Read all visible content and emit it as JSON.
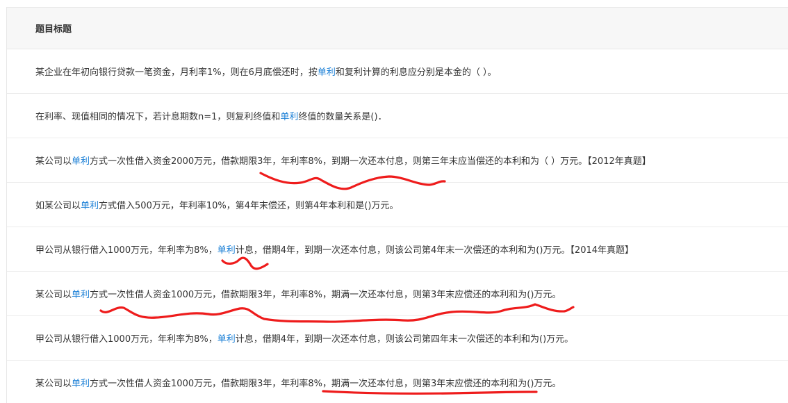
{
  "header": {
    "title": "题目标题"
  },
  "rows": [
    {
      "pre": "某企业在年初向银行贷款一笔资金，月利率1%，则在6月底偿还时，按",
      "link": "单利",
      "post": "和复利计算的利息应分别是本金的（ ）。"
    },
    {
      "pre": "在利率、现值相同的情况下，若计息期数n=1，则复利终值和",
      "link": "单利",
      "post": "终值的数量关系是()．"
    },
    {
      "pre": "某公司以",
      "link": "单利",
      "post": "方式一次性借入资金2000万元，借款期限3年，年利率8%，到期一次还本付息，则第三年末应当偿还的本利和为（ ）万元。【2012年真题】"
    },
    {
      "pre": "如某公司以",
      "link": "单利",
      "post": "方式借入500万元，年利率10%，第4年末偿还，则第4年本利和是()万元。"
    },
    {
      "pre": "甲公司从银行借入1000万元，年利率为8%，",
      "link": "单利",
      "post": "计息，借期4年，到期一次还本付息，则该公司第4年末一次偿还的本利和为()万元。【2014年真题】"
    },
    {
      "pre": "某公司以",
      "link": "单利",
      "post": "方式一次性借人资金1000万元，借款期限3年，年利率8%，期满一次还本付息，则第3年末应偿还的本利和为()万元。"
    },
    {
      "pre": "甲公司从银行借入1000万元，年利率为8%，",
      "link": "单利",
      "post": "计息，借期4年，到期一次还本付息，则该公司第四年末一次偿还的本利和为()万元。"
    },
    {
      "pre": "某公司以",
      "link": "单利",
      "post": "方式一次性借人资金1000万元，借款期限3年，年利率8%，期满一次还本付息，则第3年末应偿还的本利和为()万元。"
    }
  ],
  "colors": {
    "link": "#1a7fd6",
    "annotation": "#ee1c1c",
    "header_bg": "#f7f7f7"
  }
}
